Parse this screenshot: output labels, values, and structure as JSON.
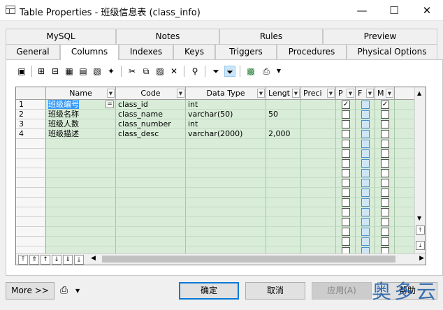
{
  "window": {
    "title": "Table Properties - 班级信息表 (class_info)",
    "minimize": "—",
    "maximize": "☐",
    "close": "✕"
  },
  "tabs_top": [
    "MySQL",
    "Notes",
    "Rules",
    "Preview"
  ],
  "tabs_bottom": [
    "General",
    "Columns",
    "Indexes",
    "Keys",
    "Triggers",
    "Procedures",
    "Physical Options"
  ],
  "active_tab": "Columns",
  "grid": {
    "headers": {
      "name": "Name",
      "code": "Code",
      "data_type": "Data Type",
      "length": "Lengt",
      "precision": "Preci",
      "p": "P",
      "f": "F",
      "m": "M"
    },
    "rows": [
      {
        "num": "1",
        "name": "班级编号",
        "code": "class_id",
        "data_type": "int",
        "length": "",
        "p": true,
        "m": true
      },
      {
        "num": "2",
        "name": "班级名称",
        "code": "class_name",
        "data_type": "varchar(50)",
        "length": "50",
        "p": false,
        "m": false
      },
      {
        "num": "3",
        "name": "班级人数",
        "code": "class_number",
        "data_type": "int",
        "length": "",
        "p": false,
        "m": false
      },
      {
        "num": "4",
        "name": "班级描述",
        "code": "class_desc",
        "data_type": "varchar(2000)",
        "length": "2,000",
        "p": false,
        "m": false
      }
    ],
    "cell_editor_button": "="
  },
  "buttons": {
    "more": "More >>",
    "ok": "确定",
    "cancel": "取消",
    "apply": "应用(A)",
    "help": "帮助"
  },
  "watermark": "奥多云"
}
